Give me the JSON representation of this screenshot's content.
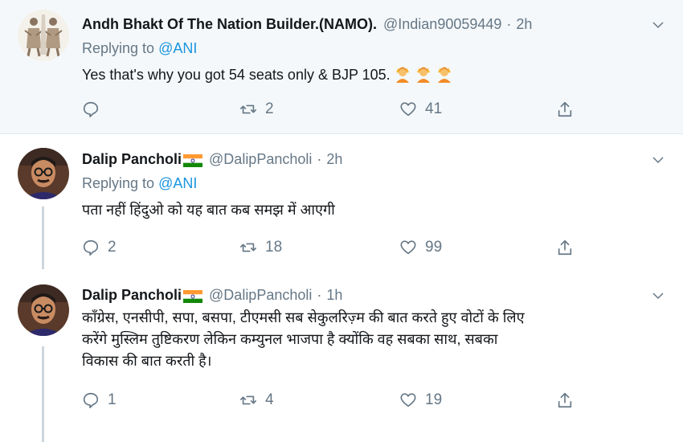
{
  "tweets": [
    {
      "name": "Andh Bhakt Of The Nation Builder.(NAMO).",
      "handle": "@Indian90059449",
      "time": "2h",
      "replying_prefix": "Replying to",
      "replying_to": "@ANI",
      "text": "Yes that's why you got 54 seats only & BJP 105.",
      "emoji": "person-with-raised-hands-emoji",
      "emoji_count": 3,
      "reply_count": "",
      "retweet_count": "2",
      "like_count": "41",
      "highlighted": true
    },
    {
      "name": "Dalip Pancholi",
      "flag": "india-flag",
      "handle": "@DalipPancholi",
      "time": "2h",
      "replying_prefix": "Replying to",
      "replying_to": "@ANI",
      "text": "पता नहीं हिंदुओ को यह बात कब समझ में आएगी",
      "reply_count": "2",
      "retweet_count": "18",
      "like_count": "99"
    },
    {
      "name": "Dalip Pancholi",
      "flag": "india-flag",
      "handle": "@DalipPancholi",
      "time": "1h",
      "text_lines": [
        "कॉंग्रेस, एनसीपी, सपा, बसपा, टीएमसी सब सेकुलरिज़्म की बात करते हुए वोटों के लिए",
        "करेंगे मुस्लिम तुष्टिकरण लेकिन कम्युनल भाजपा है क्योंकि वह सबका साथ, सबका",
        "विकास की बात करती है।"
      ],
      "reply_count": "1",
      "retweet_count": "4",
      "like_count": "19"
    }
  ],
  "separator": "·",
  "colors": {
    "accent": "#1b95e0",
    "secondary_text": "#657786",
    "highlight_bg": "#f5f8fa",
    "thread_line": "#ccd6dd"
  }
}
